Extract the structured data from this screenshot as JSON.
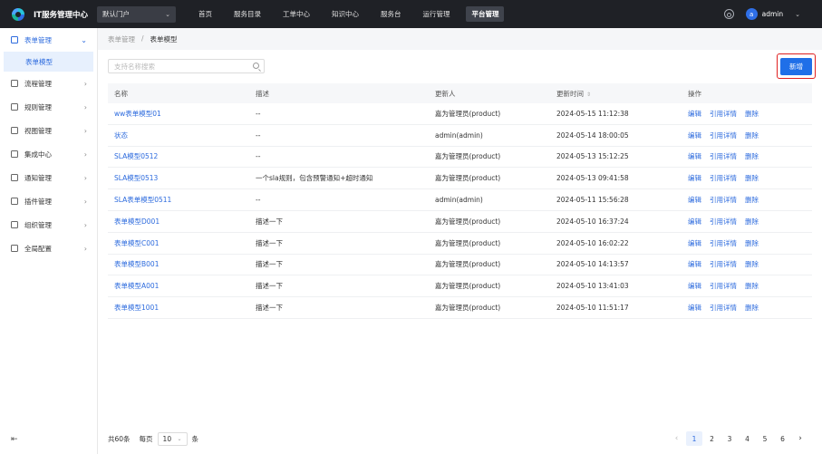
{
  "header": {
    "app_title": "IT服务管理中心",
    "portal": "默认门户",
    "nav": [
      "首页",
      "服务目录",
      "工单中心",
      "知识中心",
      "服务台",
      "运行管理",
      "平台管理"
    ],
    "active_nav": 6,
    "user": {
      "avatar_letter": "a",
      "name": "admin"
    }
  },
  "sidebar": {
    "items": [
      {
        "label": "表单管理",
        "icon": "form-icon",
        "open": true
      },
      {
        "label": "流程管理",
        "icon": "flow-icon"
      },
      {
        "label": "规则管理",
        "icon": "rule-icon"
      },
      {
        "label": "视图管理",
        "icon": "view-icon"
      },
      {
        "label": "集成中心",
        "icon": "integration-icon"
      },
      {
        "label": "通知管理",
        "icon": "bell-icon"
      },
      {
        "label": "插件管理",
        "icon": "plugin-icon"
      },
      {
        "label": "组织管理",
        "icon": "org-icon"
      },
      {
        "label": "全局配置",
        "icon": "settings-icon"
      }
    ],
    "sub_item": "表单模型"
  },
  "breadcrumb": {
    "parent": "表单管理",
    "separator": "/",
    "current": "表单模型"
  },
  "toolbar": {
    "search_placeholder": "支持名称搜索",
    "new_label": "新增"
  },
  "table": {
    "headers": {
      "name": "名称",
      "desc": "描述",
      "updater": "更新人",
      "time": "更新时间",
      "ops": "操作"
    },
    "sort_icon": "⇕",
    "ops": [
      "编辑",
      "引用详情",
      "删除"
    ],
    "rows": [
      {
        "name": "ww表单模型01",
        "desc": "--",
        "updater": "嘉为管理员(product)",
        "time": "2024-05-15 11:12:38"
      },
      {
        "name": "状态",
        "desc": "--",
        "updater": "admin(admin)",
        "time": "2024-05-14 18:00:05"
      },
      {
        "name": "SLA模型0512",
        "desc": "--",
        "updater": "嘉为管理员(product)",
        "time": "2024-05-13 15:12:25"
      },
      {
        "name": "SLA模型0513",
        "desc": "一个sla规则，包含预警通知+超时通知",
        "updater": "嘉为管理员(product)",
        "time": "2024-05-13 09:41:58"
      },
      {
        "name": "SLA表单模型0511",
        "desc": "--",
        "updater": "admin(admin)",
        "time": "2024-05-11 15:56:28"
      },
      {
        "name": "表单模型D001",
        "desc": "描述一下",
        "updater": "嘉为管理员(product)",
        "time": "2024-05-10 16:37:24"
      },
      {
        "name": "表单模型C001",
        "desc": "描述一下",
        "updater": "嘉为管理员(product)",
        "time": "2024-05-10 16:02:22"
      },
      {
        "name": "表单模型B001",
        "desc": "描述一下",
        "updater": "嘉为管理员(product)",
        "time": "2024-05-10 14:13:57"
      },
      {
        "name": "表单模型A001",
        "desc": "描述一下",
        "updater": "嘉为管理员(product)",
        "time": "2024-05-10 13:41:03"
      },
      {
        "name": "表单模型1001",
        "desc": "描述一下",
        "updater": "嘉为管理员(product)",
        "time": "2024-05-10 11:51:17"
      }
    ]
  },
  "pagination": {
    "total_text": "共60条",
    "per_page_label": "每页",
    "per_page_value": "10",
    "per_page_unit": "条",
    "pages": [
      "1",
      "2",
      "3",
      "4",
      "5",
      "6"
    ],
    "current_page": 1,
    "prev": "‹",
    "next": "›"
  },
  "colors": {
    "topbar": "#1f2126",
    "accent": "#1f6fe8",
    "highlight_border": "#e02020"
  }
}
